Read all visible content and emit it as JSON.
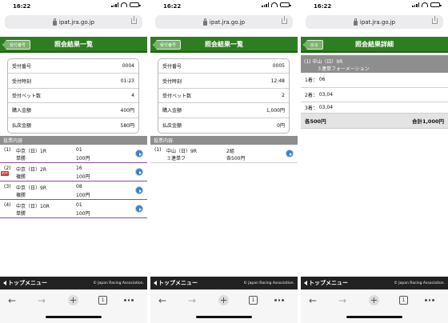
{
  "status": {
    "time": "16:22"
  },
  "browser": {
    "url": "ipat.jra.go.jp",
    "tab_count": "1"
  },
  "footer": {
    "top_menu": "トップメニュー",
    "copyright": "© Japan Racing Association."
  },
  "screen1": {
    "back_label": "受付番号",
    "title": "照会結果一覧",
    "summary": [
      {
        "label": "受付番号",
        "value": "0004"
      },
      {
        "label": "受付時刻",
        "value": "01:23"
      },
      {
        "label": "受付ベット数",
        "value": "4"
      },
      {
        "label": "購入金額",
        "value": "400円"
      },
      {
        "label": "払戻金額",
        "value": "580円"
      }
    ],
    "section_title": "投票内容",
    "votes": [
      {
        "no": "(1)",
        "race": "中京（日）1R",
        "type": "単勝",
        "number": "01",
        "amount": "100円",
        "badge": ""
      },
      {
        "no": "(2)",
        "race": "中京（日）2R",
        "type": "複勝",
        "number": "16",
        "amount": "100円",
        "badge": "的中"
      },
      {
        "no": "(3)",
        "race": "中京（日）9R",
        "type": "複勝",
        "number": "08",
        "amount": "100円",
        "badge": ""
      },
      {
        "no": "(4)",
        "race": "中京（日）10R",
        "type": "単勝",
        "number": "01",
        "amount": "100円",
        "badge": ""
      }
    ]
  },
  "screen2": {
    "back_label": "受付番号",
    "title": "照会結果一覧",
    "summary": [
      {
        "label": "受付番号",
        "value": "0005"
      },
      {
        "label": "受付時刻",
        "value": "12:48"
      },
      {
        "label": "受付ベット数",
        "value": "2"
      },
      {
        "label": "購入金額",
        "value": "1,000円"
      },
      {
        "label": "払戻金額",
        "value": "0円"
      }
    ],
    "section_title": "投票内容",
    "votes": [
      {
        "no": "(1)",
        "race": "中山（日）9R",
        "type": "３連単フ",
        "number": "2組",
        "amount": "各500円",
        "badge": ""
      }
    ]
  },
  "screen3": {
    "back_label": "戻る",
    "title": "照会結果詳細",
    "head_line1": "(1) 中山（日）9R",
    "head_line2": "３連単フォーメーション",
    "picks": [
      {
        "label": "1着：",
        "value": "06"
      },
      {
        "label": "2着：",
        "value": "03,04"
      },
      {
        "label": "3着：",
        "value": "03,04"
      }
    ],
    "each_amount": "各500円",
    "total": "合計1,000円"
  }
}
